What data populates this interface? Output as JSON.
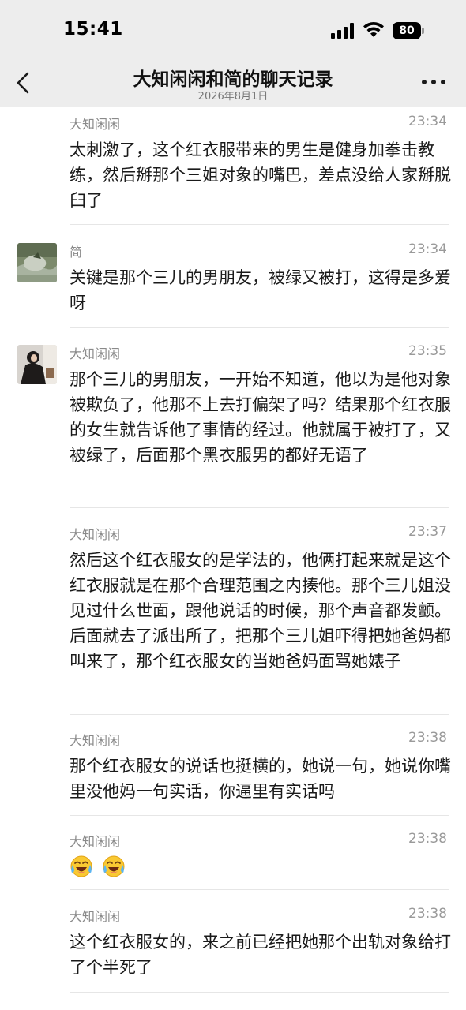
{
  "status_bar": {
    "time": "15:41",
    "battery": "80"
  },
  "header": {
    "title": "大知闲闲和简的聊天记录",
    "subtitle": "2026年8月1日"
  },
  "messages": [
    {
      "sender": "大知闲闲",
      "time": "23:34",
      "text": "太刺激了，这个红衣服带来的男生是健身加拳击教练，然后掰那个三姐对象的嘴巴，差点没给人家掰脱臼了"
    },
    {
      "sender": "简",
      "time": "23:34",
      "text": "关键是那个三儿的男朋友，被绿又被打，这得是多爱呀"
    },
    {
      "sender": "大知闲闲",
      "time": "23:35",
      "text": "那个三儿的男朋友，一开始不知道，他以为是他对象被欺负了，他那不上去打偏架了吗？结果那个红衣服的女生就告诉他了事情的经过。他就属于被打了，又被绿了，后面那个黑衣服男的都好无语了"
    },
    {
      "sender": "大知闲闲",
      "time": "23:37",
      "text": "然后这个红衣服女的是学法的，他俩打起来就是这个红衣服就是在那个合理范围之内揍他。那个三儿姐没见过什么世面，跟他说话的时候，那个声音都发颤。后面就去了派出所了，把那个三儿姐吓得把她爸妈都叫来了，那个红衣服女的当她爸妈面骂她婊子"
    },
    {
      "sender": "大知闲闲",
      "time": "23:38",
      "text": "那个红衣服女的说话也挺横的，她说一句，她说你嘴里没他妈一句实话，你逼里有实话吗"
    },
    {
      "sender": "大知闲闲",
      "time": "23:38",
      "emojis": [
        "crying-laughing",
        "crying-laughing"
      ]
    },
    {
      "sender": "大知闲闲",
      "time": "23:38",
      "text": "这个红衣服女的，来之前已经把她那个出轨对象给打了个半死了"
    }
  ]
}
